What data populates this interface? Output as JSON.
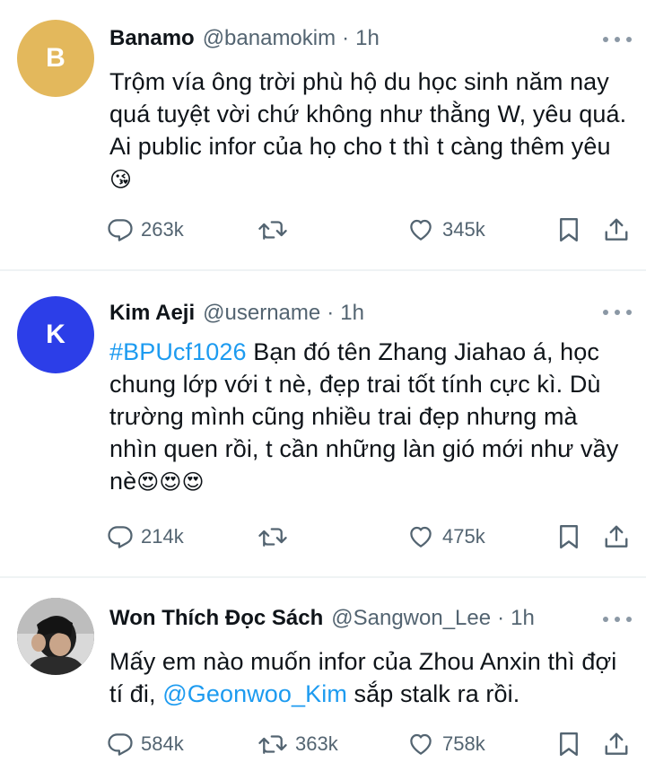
{
  "tweets": [
    {
      "avatar_letter": "B",
      "avatar_color": "#e3b85c",
      "name": "Banamo",
      "handle": "@banamokim",
      "dot": "·",
      "time": "1h",
      "text_plain": "Trộm vía ông trời phù hộ du học sinh năm nay quá tuyệt vời chứ không như thằng W, yêu quá. Ai public infor của họ cho t thì t càng thêm yêu",
      "text_emoji": "😘",
      "replies": "263k",
      "retweets": "",
      "likes": "345k"
    },
    {
      "avatar_letter": "K",
      "avatar_color": "#2c3ee8",
      "name": "Kim Aeji",
      "handle": "@username",
      "dot": "·",
      "time": "1h",
      "hashtag": "#BPUcf1026",
      "text_plain": " Bạn đó tên Zhang Jiahao á, học chung lớp với t nè, đẹp trai tốt tính cực kì. Dù trường mình cũng nhiều trai đẹp nhưng mà nhìn quen rồi, t cần những làn gió mới như vầy nè",
      "text_emoji": "😍😍😍",
      "replies": "214k",
      "retweets": "",
      "likes": "475k"
    },
    {
      "avatar_color": "#3a3a3a",
      "name": "Won Thích Đọc Sách",
      "handle": "@Sangwon_Lee",
      "dot": "·",
      "time": "1h",
      "text_before": "Mấy em nào muốn infor của Zhou Anxin thì đợi tí đi, ",
      "mention": "@Geonwoo_Kim",
      "text_after": " sắp stalk ra rồi.",
      "replies": "584k",
      "retweets": "363k",
      "likes": "758k"
    }
  ],
  "icons": {
    "reply": "reply-icon",
    "retweet": "retweet-icon",
    "like": "heart-icon",
    "bookmark": "bookmark-icon",
    "share": "share-icon",
    "more": "more-icon"
  },
  "colors": {
    "text": "#0f1419",
    "secondary": "#536471",
    "link": "#1d9bf0",
    "divider": "#eff3f4"
  }
}
